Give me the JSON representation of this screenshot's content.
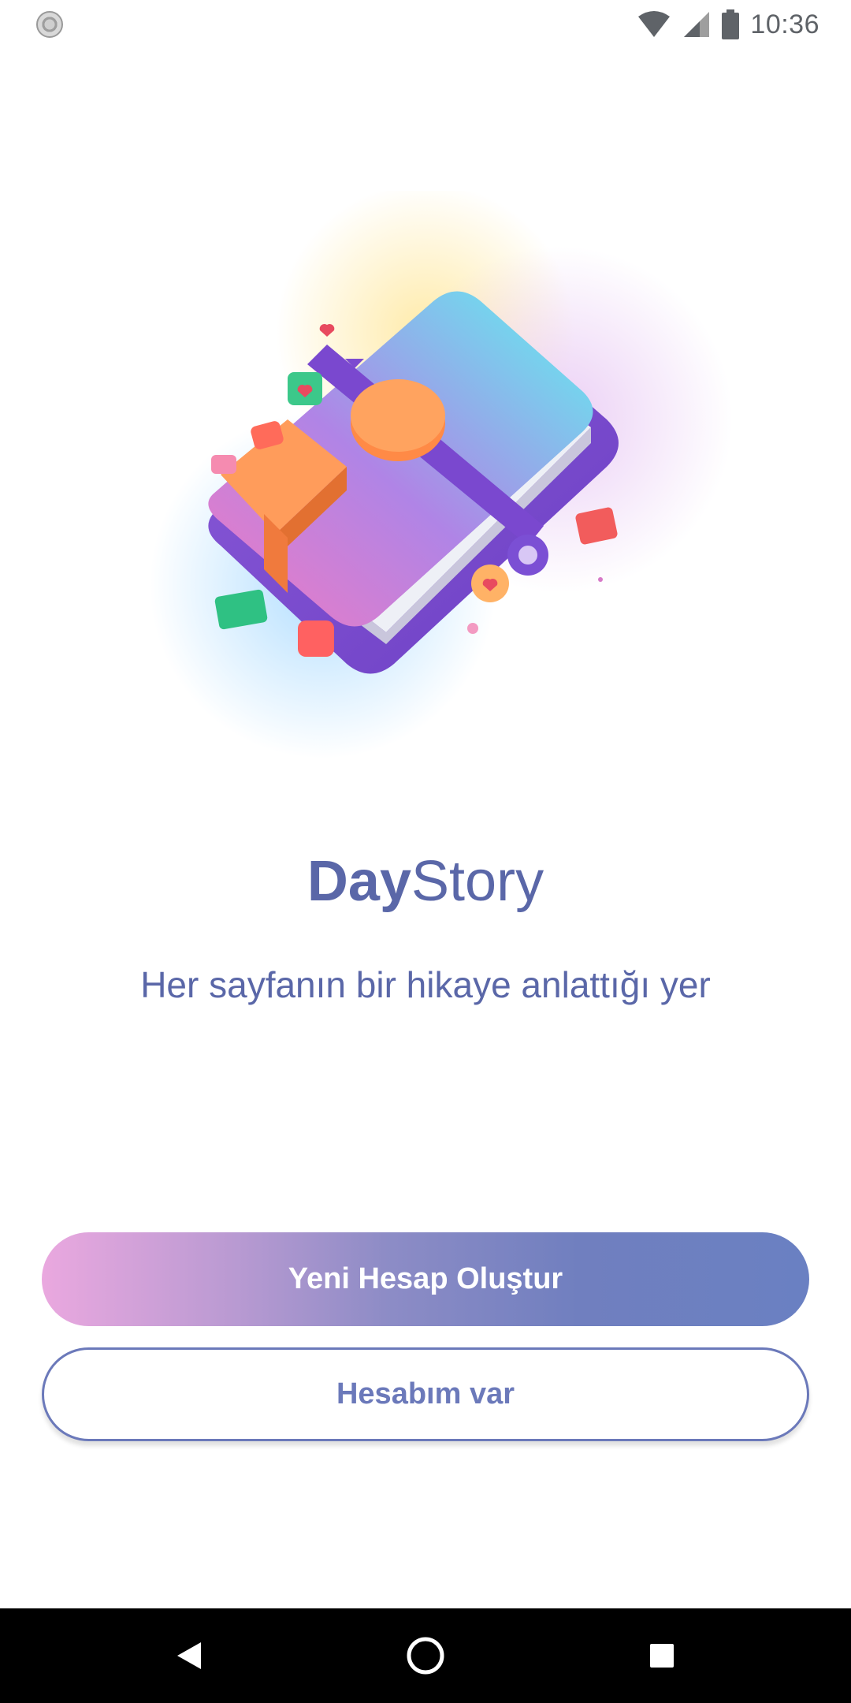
{
  "status_bar": {
    "time": "10:36",
    "icons": [
      "sync-icon",
      "wifi-icon",
      "signal-icon",
      "battery-icon"
    ]
  },
  "app": {
    "title_bold": "Day",
    "title_regular": "Story",
    "tagline": "Her sayfanın bir hikaye anlattığı yer"
  },
  "actions": {
    "create_account": "Yeni Hesap Oluştur",
    "have_account": "Hesabım var"
  },
  "nav_bar": {
    "icons": [
      "back-icon",
      "home-icon",
      "recents-icon"
    ]
  },
  "colors": {
    "brand": "#5a67a8",
    "button_gradient_start": "#eaa8df",
    "button_gradient_end": "#6a80c2",
    "outline": "#6b79ba"
  }
}
